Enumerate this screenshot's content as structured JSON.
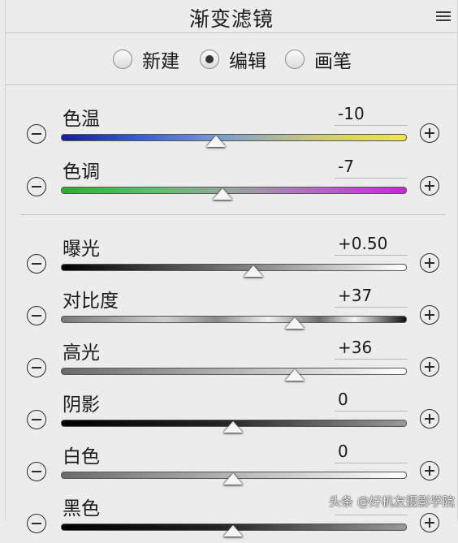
{
  "panel": {
    "title": "渐变滤镜"
  },
  "modes": [
    {
      "label": "新建",
      "selected": false
    },
    {
      "label": "编辑",
      "selected": true
    },
    {
      "label": "画笔",
      "selected": false
    }
  ],
  "sliders": [
    {
      "label": "色温",
      "value": "-10",
      "fraction": 0.45,
      "track": "blue-to-yellow"
    },
    {
      "label": "色调",
      "value": "-7",
      "fraction": 0.47,
      "track": "green-to-magenta"
    },
    {
      "label": "曝光",
      "value": "+0.50",
      "fraction": 0.56,
      "track": "black-to-white"
    },
    {
      "label": "对比度",
      "value": "+37",
      "fraction": 0.68,
      "track": "gray-striped"
    },
    {
      "label": "高光",
      "value": "+36",
      "fraction": 0.68,
      "track": "gray-to-white"
    },
    {
      "label": "阴影",
      "value": "0",
      "fraction": 0.5,
      "track": "black-to-gray"
    },
    {
      "label": "白色",
      "value": "0",
      "fraction": 0.5,
      "track": "gray-to-white"
    },
    {
      "label": "黑色",
      "value": "",
      "fraction": 0.5,
      "track": "black-to-gray"
    }
  ],
  "icons": {
    "minus": "minus-circle-icon",
    "plus": "plus-circle-icon",
    "menu": "hamburger-menu-icon"
  },
  "watermark": "头条 @好机友摄影学院"
}
